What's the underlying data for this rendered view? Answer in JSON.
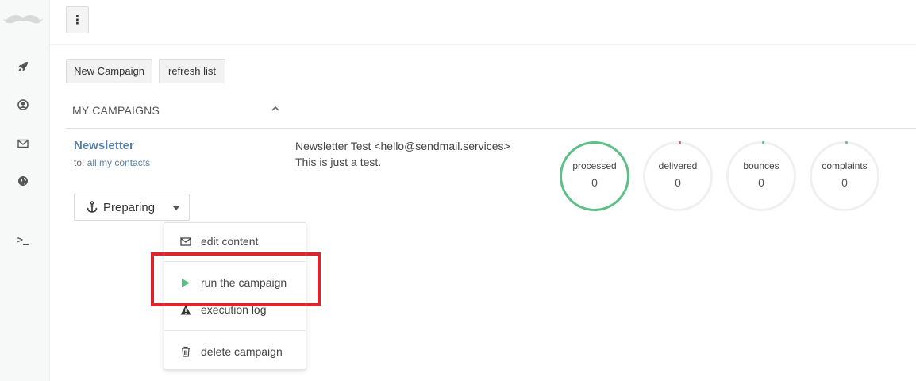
{
  "toolbar": {
    "menu_glyph": "⋮",
    "new_campaign_label": "New Campaign",
    "refresh_label": "refresh list"
  },
  "sidebar": {
    "items": [
      {
        "icon": "rocket-icon"
      },
      {
        "icon": "user-icon"
      },
      {
        "icon": "envelope-icon"
      },
      {
        "icon": "globe-icon"
      },
      {
        "icon": "terminal-icon",
        "glyph": ">_"
      }
    ]
  },
  "section": {
    "title": "MY CAMPAIGNS"
  },
  "campaign": {
    "name": "Newsletter",
    "to_prefix": "to:",
    "to_link": "all my contacts",
    "sender": "Newsletter Test <hello@sendmail.services>",
    "subject": "This is just a test.",
    "status": "Preparing",
    "stats": [
      {
        "label": "processed",
        "value": "0",
        "color": "#5cbf85"
      },
      {
        "label": "delivered",
        "value": "0",
        "color": "#e0556a"
      },
      {
        "label": "bounces",
        "value": "0",
        "color": "#5cbf85"
      },
      {
        "label": "complaints",
        "value": "0",
        "color": "#5cbf85"
      }
    ]
  },
  "dropdown": {
    "items": [
      {
        "label": "edit content",
        "icon": "envelope-icon"
      },
      {
        "label": "run the campaign",
        "icon": "play-icon"
      },
      {
        "label": "execution log",
        "icon": "warning-icon"
      },
      {
        "label": "delete campaign",
        "icon": "trash-icon"
      }
    ]
  },
  "colors": {
    "accent_link": "#5a80a8",
    "success": "#5cbf85",
    "highlight": "#d9262f"
  }
}
